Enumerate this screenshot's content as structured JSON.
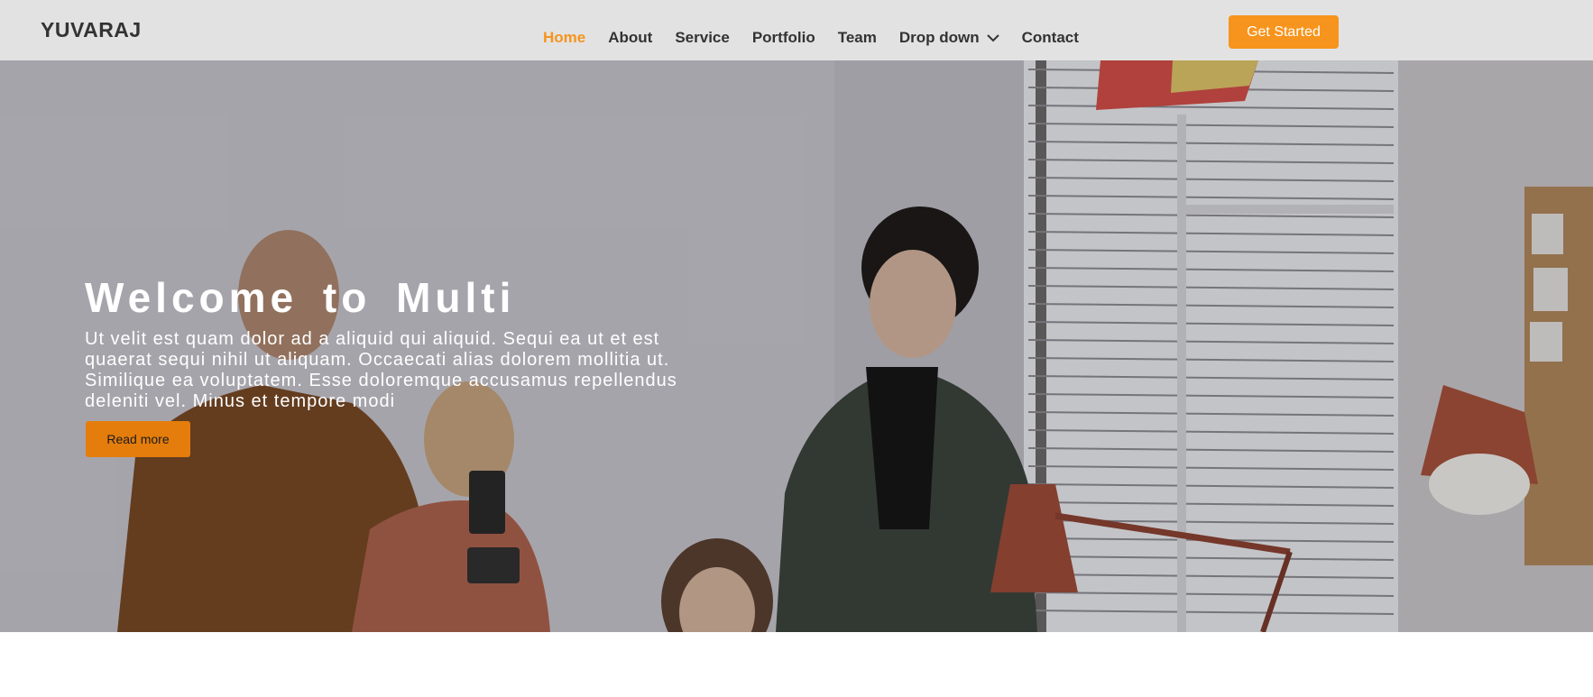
{
  "header": {
    "brand": "YUVARAJ",
    "nav": [
      {
        "label": "Home",
        "active": true
      },
      {
        "label": "About"
      },
      {
        "label": "Service"
      },
      {
        "label": "Portfolio"
      },
      {
        "label": "Team"
      },
      {
        "label": "Drop down",
        "icon": "chevron-down-icon"
      },
      {
        "label": "Contact"
      }
    ],
    "cta_label": "Get Started"
  },
  "hero": {
    "title": "Welcome to Multi",
    "text": "Ut velit est quam dolor ad a aliquid qui aliquid. Sequi ea ut et est quaerat sequi nihil ut aliquam. Occaecati alias dolorem mollitia ut. Similique ea voluptatem. Esse doloremque accusamus repellendus deleniti vel. Minus et tempore modi",
    "button_label": "Read more"
  },
  "colors": {
    "accent": "#f7941d",
    "hero_button": "#e47d0c",
    "header_bg": "#e2e2e2",
    "text_dark": "#333333"
  }
}
